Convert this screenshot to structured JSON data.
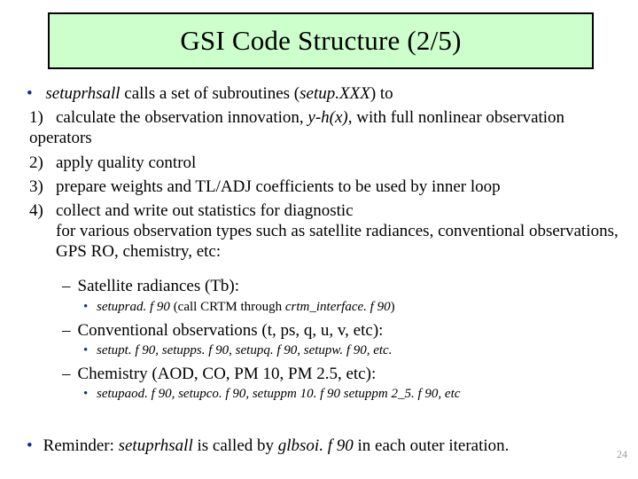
{
  "title": "GSI Code Structure (2/5)",
  "intro": {
    "func": "setuprhsall",
    "mid": " calls a set of subroutines (",
    "pattern": "setup.XXX",
    "tail": ") to"
  },
  "steps": {
    "s1a": "calculate the observation innovation, ",
    "s1b": "y-h(x)",
    "s1c": ", with full nonlinear observation operators",
    "s2": "apply quality control",
    "s3": "prepare weights and TL/ADJ coefficients to be used by inner loop",
    "s4a": "collect and write out statistics for diagnostic",
    "s4b": "for various observation types such as satellite radiances, conventional observations, GPS RO, chemistry, etc:"
  },
  "sub": {
    "sat": {
      "head": "Satellite radiances (Tb):",
      "f1": "setuprad. f 90",
      "mid": " (call CRTM through ",
      "f2": "crtm_interface. f 90",
      "tail": ")"
    },
    "conv": {
      "head": "Conventional observations (t, ps, q, u, v, etc):",
      "files": "setupt. f 90, setupps. f 90, setupq. f 90, setupw. f 90, etc."
    },
    "chem": {
      "head": "Chemistry (AOD, CO, PM 10, PM 2.5, etc):",
      "files": "setupaod. f 90, setupco. f 90, setuppm 10. f 90 setuppm 2_5. f 90, etc"
    }
  },
  "reminder": {
    "a": "Reminder: ",
    "b": "setuprhsall",
    "c": " is called by ",
    "d": "glbsoi. f 90",
    "e": " in each outer iteration."
  },
  "page": "24"
}
